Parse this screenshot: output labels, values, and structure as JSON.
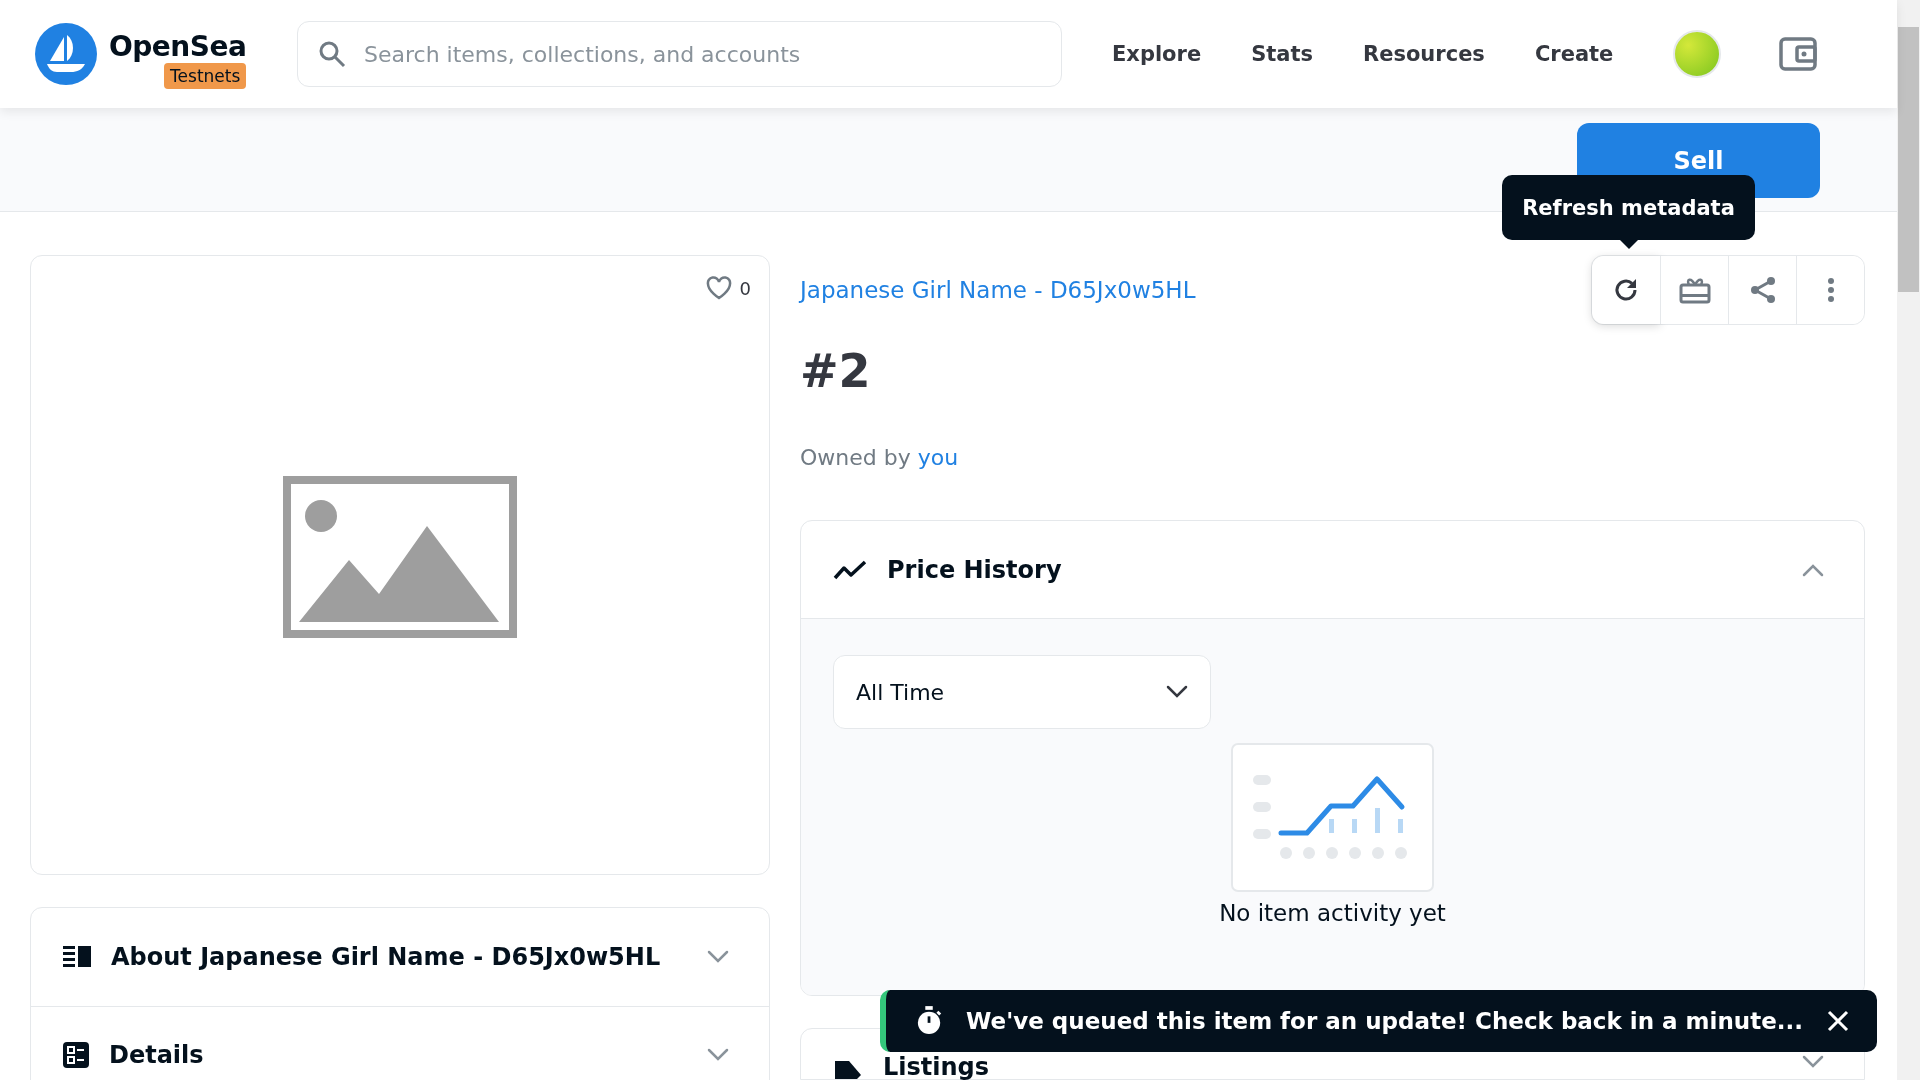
{
  "header": {
    "logo_text": "OpenSea",
    "badge": "Testnets",
    "search": {
      "placeholder": "Search items, collections, and accounts"
    },
    "nav": [
      "Explore",
      "Stats",
      "Resources",
      "Create"
    ]
  },
  "sell_button": "Sell",
  "tooltip": "Refresh metadata",
  "item_card": {
    "likes": "0"
  },
  "collection": "Japanese Girl Name - D65Jx0w5HL",
  "title": "#2",
  "owner": {
    "label": "Owned by",
    "name": "you"
  },
  "actions": [
    {
      "kind": "refresh"
    },
    {
      "kind": "gift"
    },
    {
      "kind": "share"
    },
    {
      "kind": "more"
    }
  ],
  "left_panels": [
    {
      "kind": "about",
      "title": "About Japanese Girl Name - D65Jx0w5HL",
      "expanded": false
    },
    {
      "kind": "details",
      "title": "Details",
      "expanded": false
    }
  ],
  "price_history": {
    "title": "Price History",
    "expanded": true,
    "range": "All Time",
    "empty_text": "No item activity yet"
  },
  "listings": {
    "title": "Listings",
    "expanded": false
  },
  "toast": {
    "message": "We've queued this item for an update! Check back in a minute..."
  }
}
